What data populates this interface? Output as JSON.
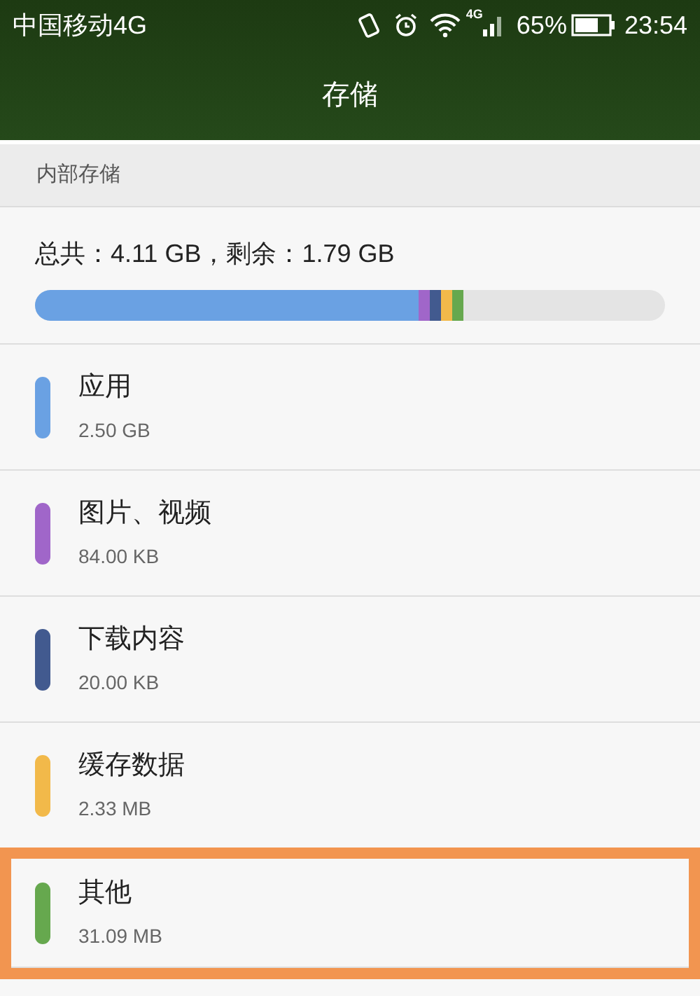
{
  "status_bar": {
    "carrier": "中国移动4G",
    "network": "4G",
    "battery": "65%",
    "time": "23:54"
  },
  "header": {
    "title": "存储"
  },
  "section": {
    "title": "内部存储"
  },
  "summary": {
    "text": "总共：4.11 GB，剩余：1.79 GB"
  },
  "categories": [
    {
      "name": "应用",
      "size": "2.50 GB",
      "color": "#6aa1e3",
      "highlighted": false
    },
    {
      "name": "图片、视频",
      "size": "84.00 KB",
      "color": "#a066c9",
      "highlighted": false
    },
    {
      "name": "下载内容",
      "size": "20.00 KB",
      "color": "#425a8f",
      "highlighted": false
    },
    {
      "name": "缓存数据",
      "size": "2.33 MB",
      "color": "#f2b94a",
      "highlighted": false
    },
    {
      "name": "其他",
      "size": "31.09 MB",
      "color": "#66a84e",
      "highlighted": true
    }
  ]
}
